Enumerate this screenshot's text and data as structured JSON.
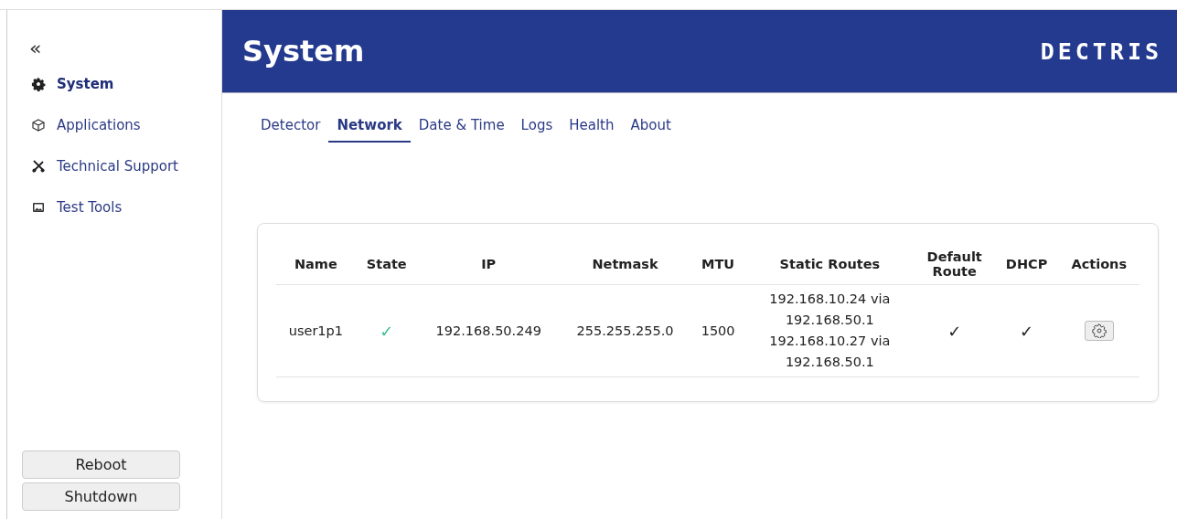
{
  "sidebar": {
    "collapse": "«",
    "items": [
      {
        "label": "System",
        "selected": true
      },
      {
        "label": "Applications",
        "selected": false
      },
      {
        "label": "Technical Support",
        "selected": false
      },
      {
        "label": "Test Tools",
        "selected": false
      }
    ],
    "buttons": [
      "Reboot",
      "Shutdown"
    ]
  },
  "header": {
    "title": "System",
    "logo": "DECTRIS"
  },
  "tabs": [
    {
      "label": "Detector",
      "selected": false
    },
    {
      "label": "Network",
      "selected": true
    },
    {
      "label": "Date & Time",
      "selected": false
    },
    {
      "label": "Logs",
      "selected": false
    },
    {
      "label": "Health",
      "selected": false
    },
    {
      "label": "About",
      "selected": false
    }
  ],
  "table": {
    "columns": [
      "Name",
      "State",
      "IP",
      "Netmask",
      "MTU",
      "Static Routes",
      "Default Route",
      "DHCP",
      "Actions"
    ],
    "rows": [
      {
        "name": "user1p1",
        "state": "✓",
        "ip": "192.168.50.249",
        "netmask": "255.255.255.0",
        "mtu": "1500",
        "static_routes": [
          "192.168.10.24 via 192.168.50.1",
          "192.168.10.27 via 192.168.50.1"
        ],
        "default_route": "✓",
        "dhcp": "✓"
      }
    ]
  }
}
